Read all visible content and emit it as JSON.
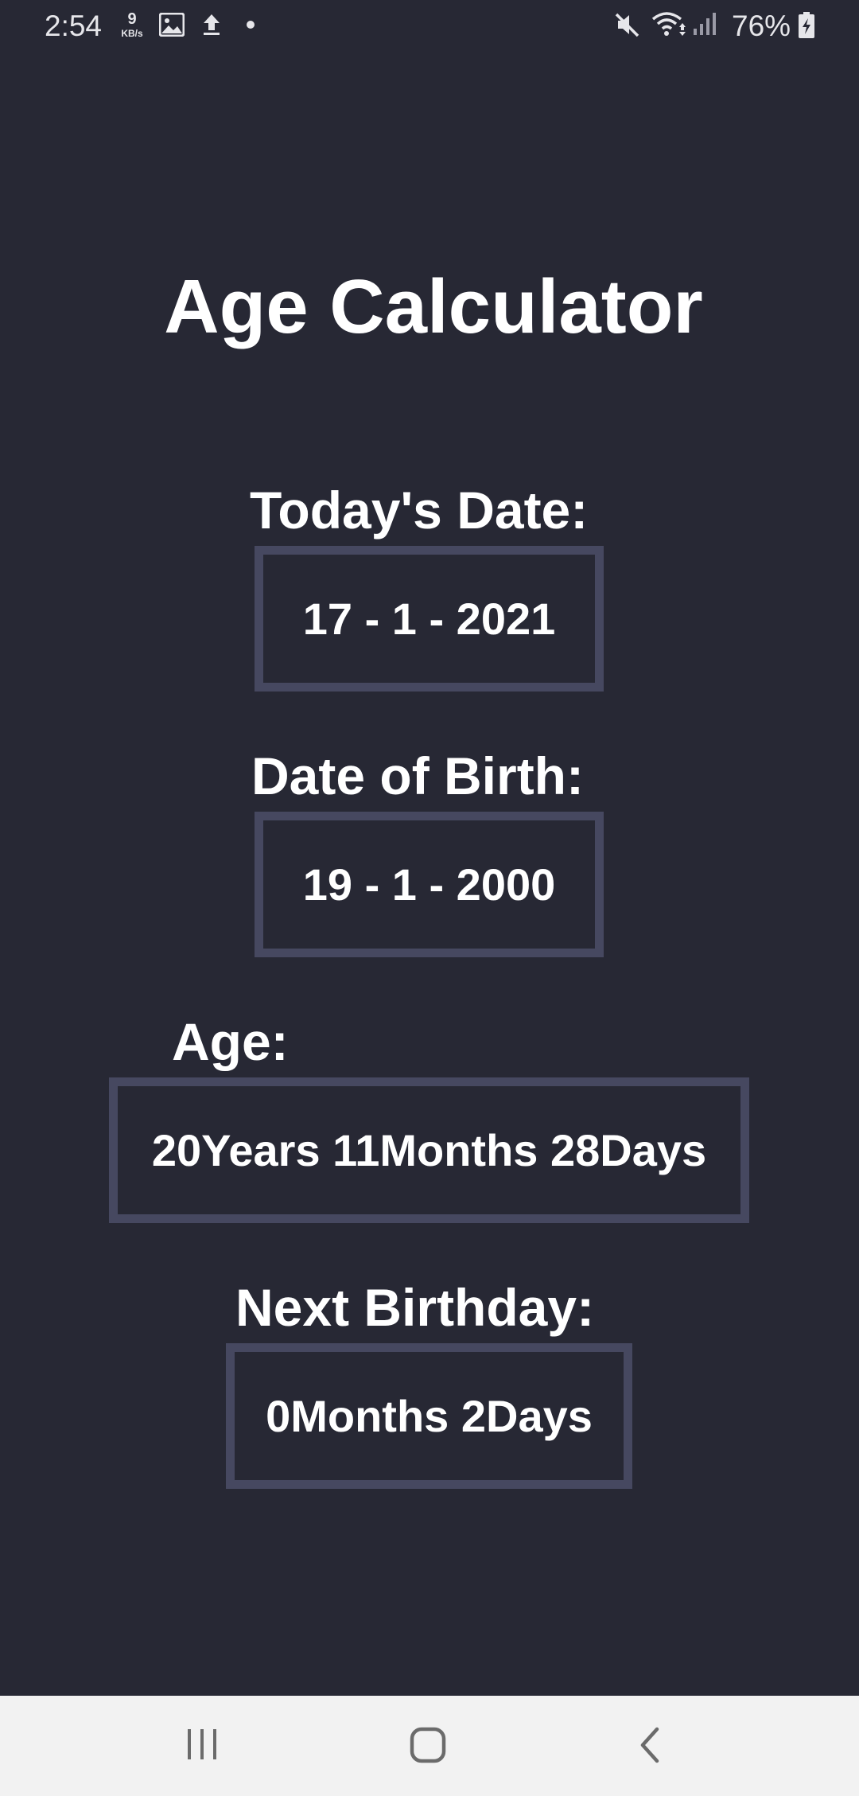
{
  "status_bar": {
    "time": "2:54",
    "net_speed_value": "9",
    "net_speed_unit": "KB/s",
    "battery_percent": "76%",
    "icons": [
      "gallery-icon",
      "upload-icon",
      "dot-icon",
      "mute-icon",
      "wifi-icon",
      "signal-icon",
      "battery-charging-icon"
    ]
  },
  "app": {
    "title": "Age Calculator",
    "todays_date_label": "Today's Date:",
    "todays_date_value": "17 - 1 - 2021",
    "dob_label": "Date of Birth:",
    "dob_value": "19 - 1 - 2000",
    "age_label": "Age:",
    "age_value": "20Years 11Months 28Days",
    "next_birthday_label": "Next Birthday:",
    "next_birthday_value": "0Months 2Days"
  },
  "nav_bar": {
    "icons": [
      "recent-apps-icon",
      "home-icon",
      "back-icon"
    ]
  },
  "colors": {
    "background": "#272834",
    "box_border": "#464860",
    "text": "#ffffff",
    "nav_background": "#f2f2f2"
  }
}
